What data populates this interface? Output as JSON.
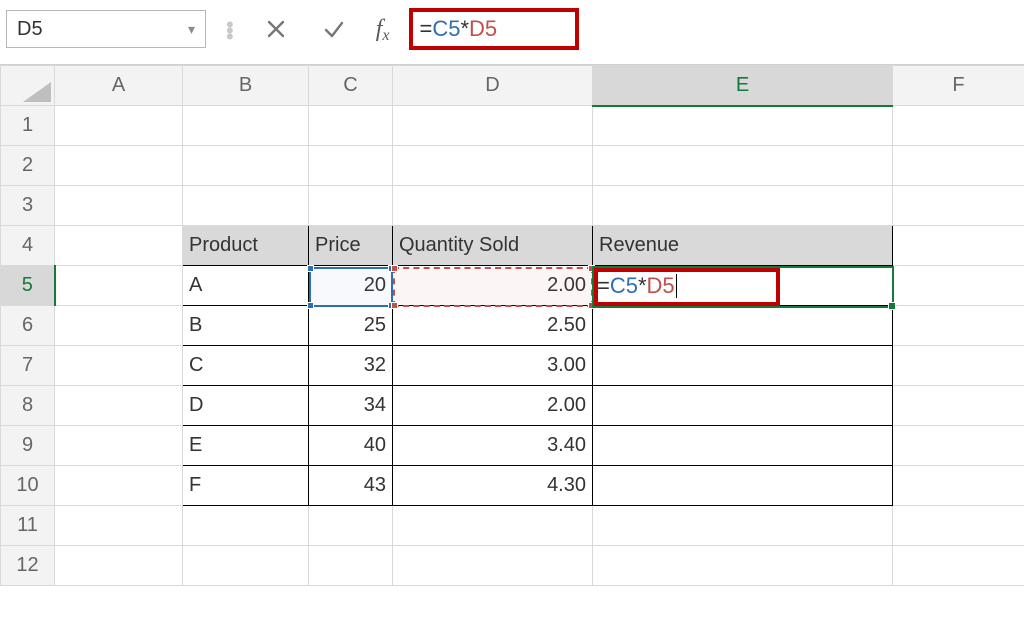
{
  "formula_bar": {
    "cell_ref": "D5",
    "formula_prefix": "=",
    "formula_ref1": "C5",
    "formula_op": "*",
    "formula_ref2": "D5"
  },
  "columns": {
    "A": "A",
    "B": "B",
    "C": "C",
    "D": "D",
    "E": "E",
    "F": "F"
  },
  "rows": {
    "r1": "1",
    "r2": "2",
    "r3": "3",
    "r4": "4",
    "r5": "5",
    "r6": "6",
    "r7": "7",
    "r8": "8",
    "r9": "9",
    "r10": "10",
    "r11": "11",
    "r12": "12"
  },
  "table": {
    "headers": {
      "product": "Product",
      "price": "Price",
      "qty": "Quantity Sold",
      "revenue": "Revenue"
    },
    "rows": [
      {
        "product": "A",
        "price": "20",
        "qty": "2.00"
      },
      {
        "product": "B",
        "price": "25",
        "qty": "2.50"
      },
      {
        "product": "C",
        "price": "32",
        "qty": "3.00"
      },
      {
        "product": "D",
        "price": "34",
        "qty": "2.00"
      },
      {
        "product": "E",
        "price": "40",
        "qty": "3.40"
      },
      {
        "product": "F",
        "price": "43",
        "qty": "4.30"
      }
    ]
  },
  "editing": {
    "eq": "=",
    "ref1": "C5",
    "op": "*",
    "ref2": "D5"
  },
  "chart_data": {
    "type": "table",
    "columns": [
      "Product",
      "Price",
      "Quantity Sold",
      "Revenue"
    ],
    "rows": [
      [
        "A",
        20,
        2.0,
        null
      ],
      [
        "B",
        25,
        2.5,
        null
      ],
      [
        "C",
        32,
        3.0,
        null
      ],
      [
        "D",
        34,
        2.0,
        null
      ],
      [
        "E",
        40,
        3.4,
        null
      ],
      [
        "F",
        43,
        4.3,
        null
      ]
    ],
    "formula_in_E5": "=C5*D5"
  }
}
